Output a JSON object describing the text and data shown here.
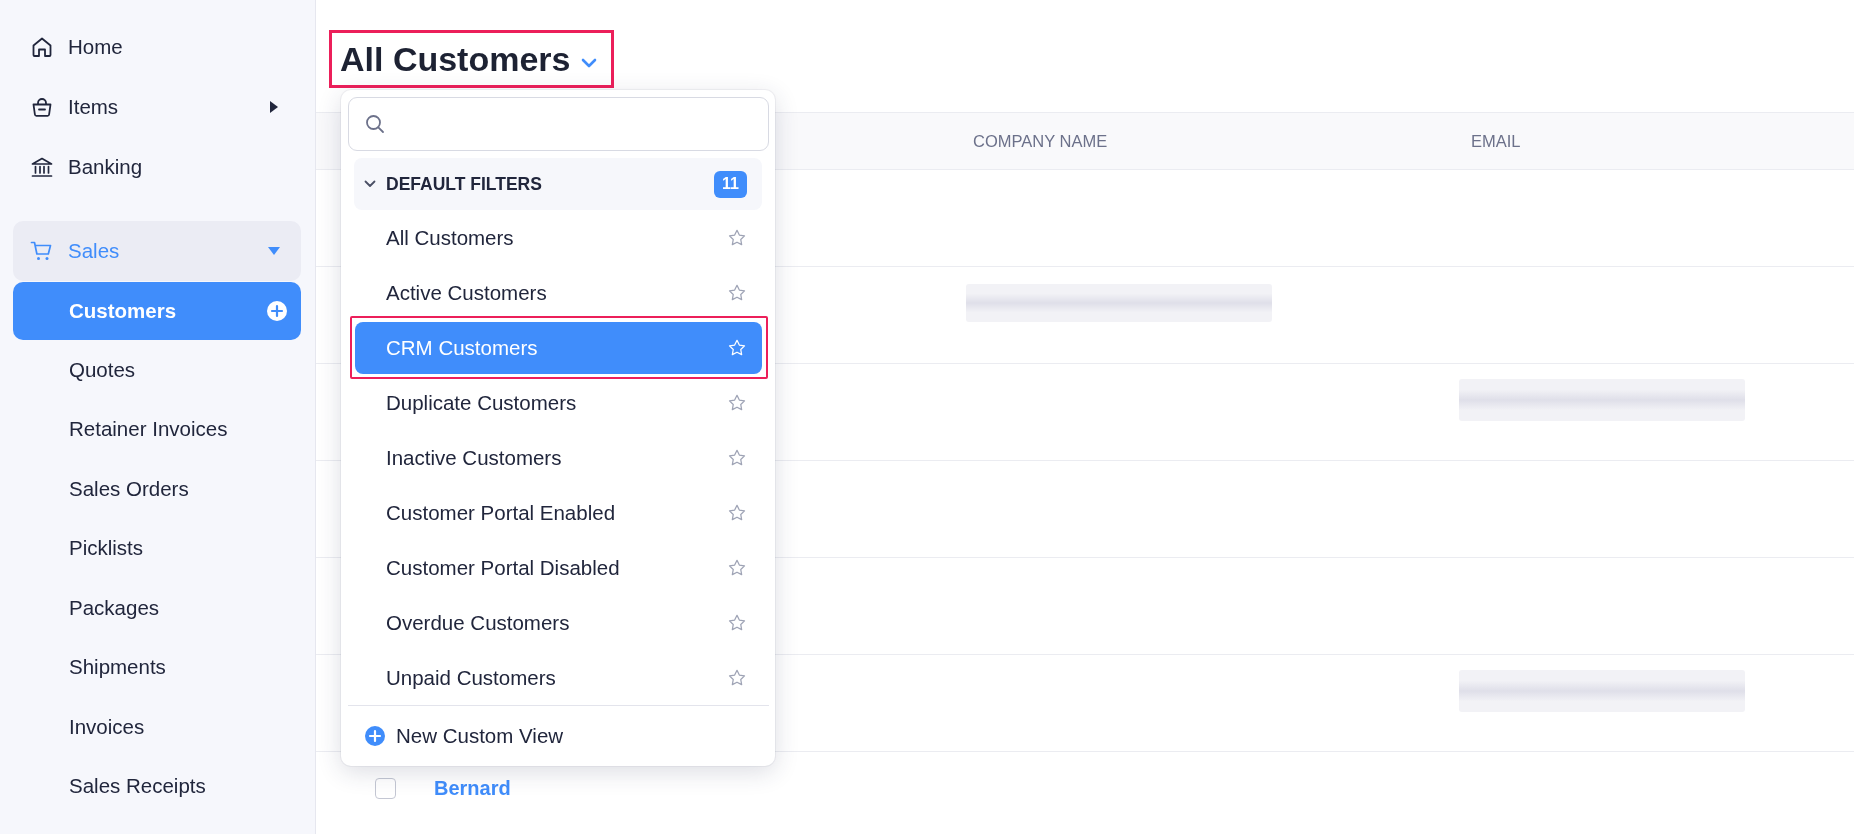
{
  "sidebar": {
    "items": [
      {
        "label": "Home",
        "selected": false
      },
      {
        "label": "Items",
        "selected": false,
        "expanded": false
      },
      {
        "label": "Banking",
        "selected": false
      },
      {
        "label": "Sales",
        "selected": true,
        "expanded": true,
        "children": [
          {
            "label": "Customers",
            "selected": true
          },
          {
            "label": "Quotes",
            "selected": false
          },
          {
            "label": "Retainer Invoices",
            "selected": false
          },
          {
            "label": "Sales Orders",
            "selected": false
          },
          {
            "label": "Picklists",
            "selected": false
          },
          {
            "label": "Packages",
            "selected": false
          },
          {
            "label": "Shipments",
            "selected": false
          },
          {
            "label": "Invoices",
            "selected": false
          },
          {
            "label": "Sales Receipts",
            "selected": false
          }
        ]
      }
    ]
  },
  "view_selector": {
    "title": "All Customers",
    "annotated": true
  },
  "table": {
    "columns": [
      {
        "label": "COMPANY NAME"
      },
      {
        "label": "EMAIL"
      }
    ],
    "rows": [
      {
        "company_redacted": false,
        "email_redacted": false
      },
      {
        "company_redacted": true,
        "email_redacted": false
      },
      {
        "company_redacted": false,
        "email_redacted": true
      },
      {
        "company_redacted": false,
        "email_redacted": false
      },
      {
        "company_redacted": false,
        "email_redacted": false
      },
      {
        "company_redacted": false,
        "email_redacted": true
      },
      {
        "name": "Bernard",
        "checked": false,
        "company_redacted": false,
        "email_redacted": false
      }
    ]
  },
  "view_dropdown": {
    "group": {
      "label": "DEFAULT FILTERS",
      "count": "11",
      "expanded": true
    },
    "items": [
      {
        "label": "All Customers",
        "selected": false,
        "favorite": false,
        "annotated": false
      },
      {
        "label": "Active Customers",
        "selected": false,
        "favorite": false,
        "annotated": false
      },
      {
        "label": "CRM Customers",
        "selected": true,
        "favorite": false,
        "annotated": true
      },
      {
        "label": "Duplicate Customers",
        "selected": false,
        "favorite": false,
        "annotated": false
      },
      {
        "label": "Inactive Customers",
        "selected": false,
        "favorite": false,
        "annotated": false
      },
      {
        "label": "Customer Portal Enabled",
        "selected": false,
        "favorite": false,
        "annotated": false
      },
      {
        "label": "Customer Portal Disabled",
        "selected": false,
        "favorite": false,
        "annotated": false
      },
      {
        "label": "Overdue Customers",
        "selected": false,
        "favorite": false,
        "annotated": false
      },
      {
        "label": "Unpaid Customers",
        "selected": false,
        "favorite": false,
        "annotated": false
      }
    ],
    "footer": {
      "label": "New Custom View"
    }
  }
}
